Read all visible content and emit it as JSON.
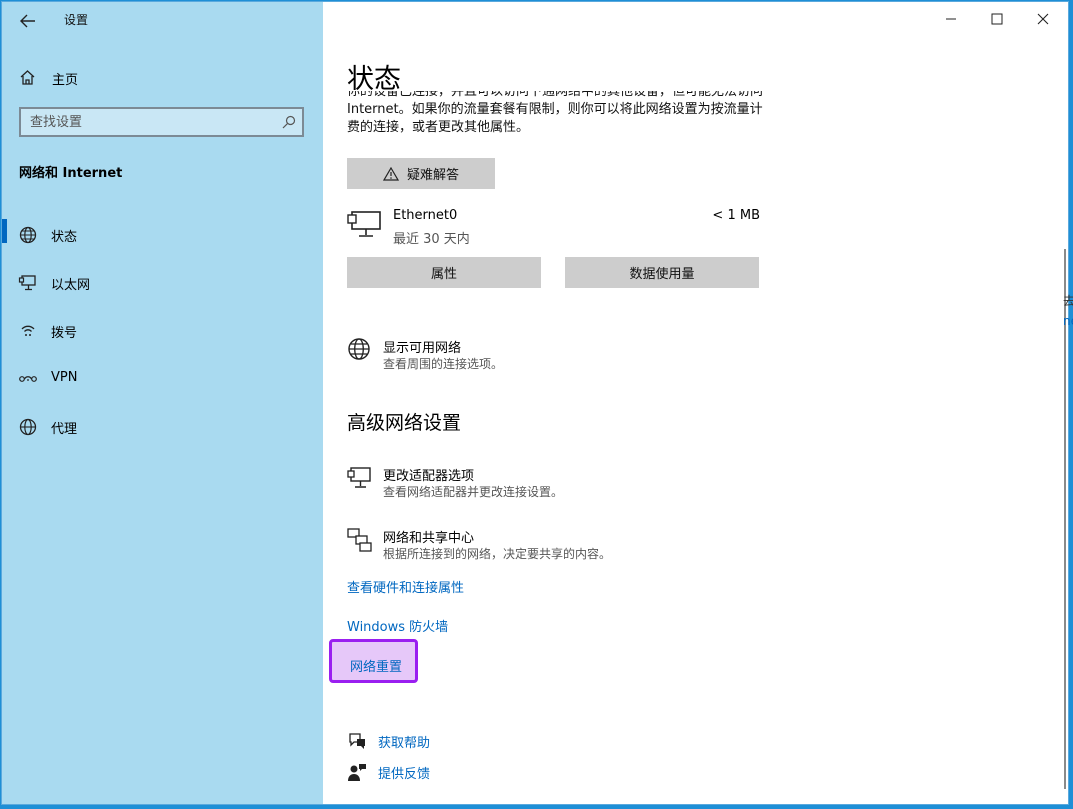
{
  "app": {
    "title": "设置"
  },
  "window_controls": {
    "minimize": "minimize-icon",
    "maximize": "maximize-icon",
    "close": "close-icon"
  },
  "sidebar": {
    "home_label": "主页",
    "search_placeholder": "查找设置",
    "section_title": "网络和 Internet",
    "items": [
      {
        "label": "状态",
        "icon": "globe-icon",
        "active": true
      },
      {
        "label": "以太网",
        "icon": "ethernet-icon",
        "active": false
      },
      {
        "label": "拨号",
        "icon": "dialup-icon",
        "active": false
      },
      {
        "label": "VPN",
        "icon": "vpn-icon",
        "active": false
      },
      {
        "label": "代理",
        "icon": "globe-icon",
        "active": false
      }
    ]
  },
  "main": {
    "title": "状态",
    "description": "你的设备已连接，并且可以访问下通网络中的其他设备，但可能无法访问 Internet。如果你的流量套餐有限制，则你可以将此网络设置为按流量计费的连接，或者更改其他属性。",
    "troubleshoot_label": "疑难解答",
    "ethernet": {
      "name": "Ethernet0",
      "sub": "最近 30 天内",
      "usage": "< 1 MB"
    },
    "properties_label": "属性",
    "data_usage_label": "数据使用量",
    "show_networks": {
      "title": "显示可用网络",
      "sub": "查看周围的连接选项。"
    },
    "advanced_heading": "高级网络设置",
    "adapter_options": {
      "title": "更改适配器选项",
      "sub": "查看网络适配器并更改连接设置。"
    },
    "sharing_center": {
      "title": "网络和共享中心",
      "sub": "根据所连接到的网络，决定要共享的内容。"
    },
    "links": {
      "hardware": "查看硬件和连接属性",
      "firewall": "Windows 防火墙",
      "reset": "网络重置"
    },
    "help": {
      "get_help": "获取帮助",
      "feedback": "提供反馈"
    }
  },
  "edge_fragments": {
    "line1": "去",
    "line2": "ne"
  },
  "colors": {
    "sidebar_bg": "#a9daf0",
    "accent": "#0067c0",
    "highlight_border": "#9a1ff0",
    "highlight_fill": "#e6c8f9"
  }
}
